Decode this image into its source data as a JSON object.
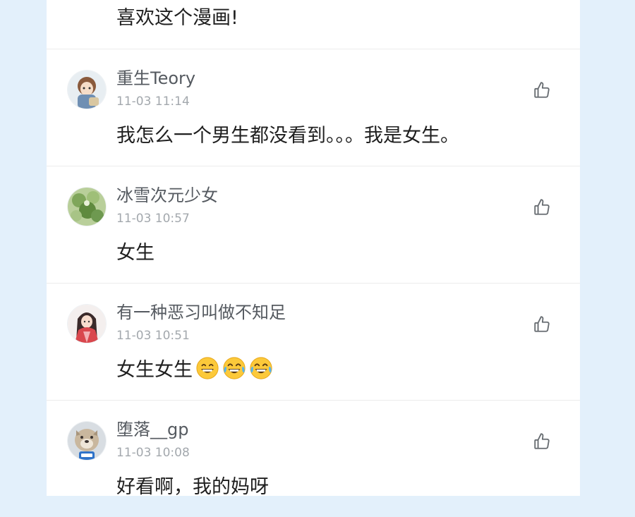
{
  "top_comment": {
    "content": "喜欢这个漫画!"
  },
  "comments": [
    {
      "username": "重生Teory",
      "timestamp": "11-03 11:14",
      "content": "我怎么一个男生都没看到。。。我是女生。",
      "avatar": "anime-boy-avatar"
    },
    {
      "username": "冰雪次元少女",
      "timestamp": "11-03 10:57",
      "content": "女生",
      "avatar": "green-nature-avatar"
    },
    {
      "username": "有一种恶习叫做不知足",
      "timestamp": "11-03 10:51",
      "content": "女生女生",
      "emojis": [
        "grinning-face-emoji",
        "tears-of-joy-emoji",
        "tears-of-joy-emoji"
      ],
      "avatar": "anime-girl-red-avatar"
    },
    {
      "username": "堕落__gp",
      "timestamp": "11-03 10:08",
      "content": "好看啊，我的妈呀",
      "avatar": "dog-avatar"
    }
  ],
  "icons": {
    "like": "thumbs-up-icon"
  },
  "colors": {
    "background": "#e3f0fb",
    "panel": "#ffffff",
    "username": "#555a60",
    "timestamp": "#a3a8ad",
    "content": "#1f1f1f",
    "divider": "#ececec"
  }
}
